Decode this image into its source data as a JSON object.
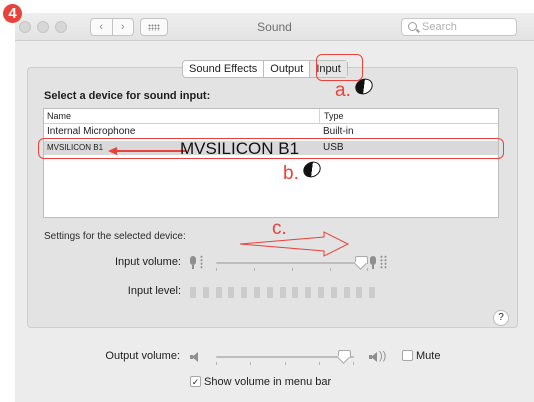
{
  "step_badge": "4",
  "window": {
    "title": "Sound",
    "nav_back": "‹",
    "nav_forward": "›",
    "search_placeholder": "Search"
  },
  "tabs": [
    "Sound Effects",
    "Output",
    "Input"
  ],
  "active_tab": "Input",
  "input_section": {
    "title": "Select a device for sound input:",
    "columns": {
      "name": "Name",
      "type": "Type"
    },
    "devices": [
      {
        "name": "Internal Microphone",
        "type": "Built-in"
      },
      {
        "name": "MVSILICON B1",
        "type": "USB"
      }
    ],
    "selected_device": "MVSILICON B1"
  },
  "settings": {
    "title": "Settings for the selected device:",
    "input_volume_label": "Input volume:",
    "input_volume_level": 0.95,
    "input_level_label": "Input level:",
    "input_level_segments": 15,
    "input_level_active": 0
  },
  "help_label": "?",
  "output": {
    "volume_label": "Output volume:",
    "volume_level": 0.92,
    "waves": "))",
    "mute_label": "Mute",
    "mute_checked": false,
    "show_volume_label": "Show volume in menu bar",
    "show_volume_checked": true,
    "check_mark": "✓"
  },
  "annotations": {
    "a": "a.",
    "b": "b.",
    "c": "c.",
    "device_callout": "MVSILICON B1",
    "color": "#e8423c"
  }
}
